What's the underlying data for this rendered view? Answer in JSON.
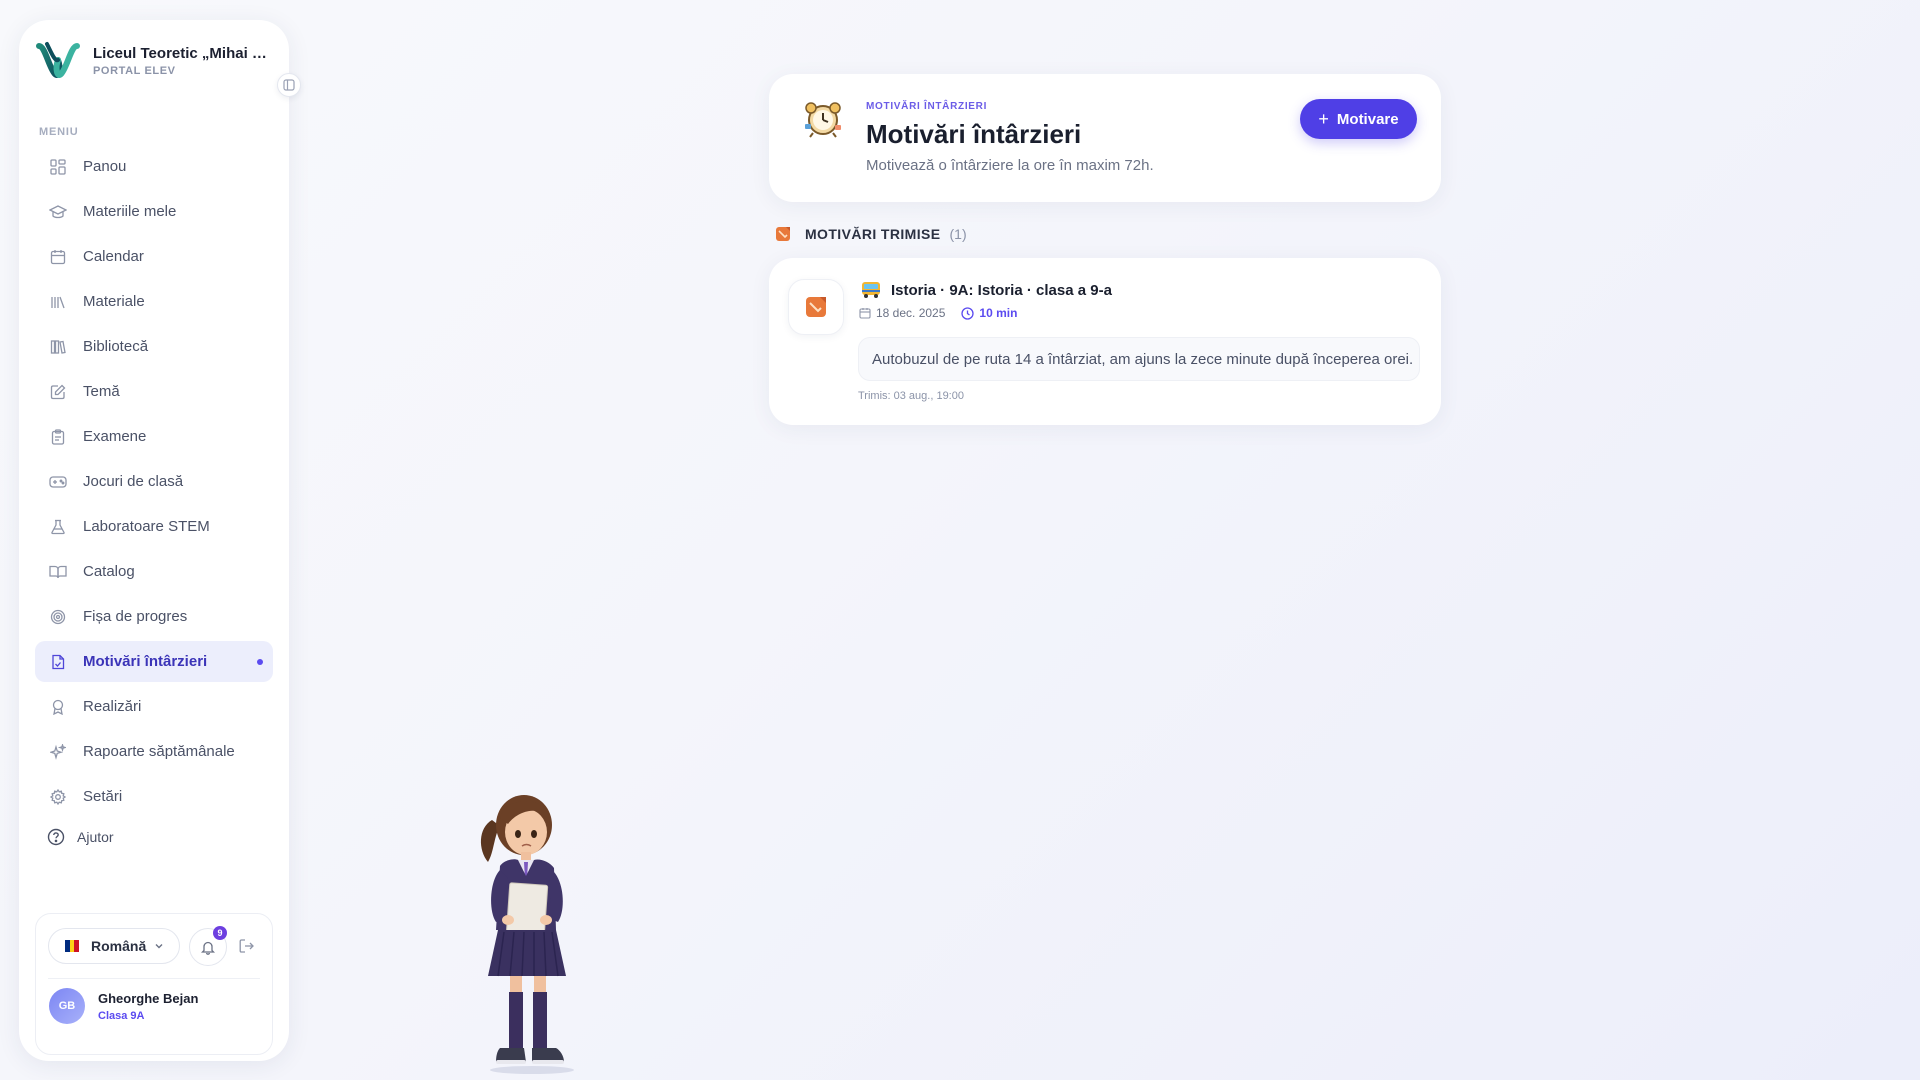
{
  "brand": {
    "name": "Liceul Teoretic „Mihai Eminescu”",
    "subtitle": "PORTAL ELEV"
  },
  "sidebar": {
    "menu_label": "MENIU",
    "items": [
      {
        "label": "Panou",
        "icon": "dashboard-icon"
      },
      {
        "label": "Materiile mele",
        "icon": "graduation-cap-icon"
      },
      {
        "label": "Calendar",
        "icon": "calendar-icon"
      },
      {
        "label": "Materiale",
        "icon": "books-icon"
      },
      {
        "label": "Bibliotecă",
        "icon": "library-icon"
      },
      {
        "label": "Temă",
        "icon": "edit-icon"
      },
      {
        "label": "Examene",
        "icon": "clipboard-icon"
      },
      {
        "label": "Jocuri de clasă",
        "icon": "gamepad-icon"
      },
      {
        "label": "Laboratoare STEM",
        "icon": "flask-icon"
      },
      {
        "label": "Catalog",
        "icon": "book-open-icon"
      },
      {
        "label": "Fișa de progres",
        "icon": "target-icon"
      },
      {
        "label": "Motivări întârzieri",
        "icon": "file-check-icon",
        "active": true
      },
      {
        "label": "Realizări",
        "icon": "award-icon"
      },
      {
        "label": "Rapoarte săptămânale",
        "icon": "sparkles-icon"
      },
      {
        "label": "Setări",
        "icon": "gear-icon"
      }
    ],
    "help_label": "Ajutor",
    "language": "Română",
    "notifications_count": "9",
    "user": {
      "initials": "GB",
      "name": "Gheorghe Bejan",
      "class": "Clasa 9A"
    }
  },
  "header": {
    "eyebrow": "MOTIVĂRI ÎNTÂRZIERI",
    "title": "Motivări întârzieri",
    "subtitle": "Motivează o întârziere la ore în maxim 72h.",
    "button_label": "Motivare"
  },
  "section": {
    "title": "MOTIVĂRI TRIMISE",
    "count": "(1)"
  },
  "submissions": [
    {
      "title": "Istoria · 9A: Istoria · clasa a 9-a",
      "date": "18 dec. 2025",
      "duration": "10 min",
      "note": "Autobuzul de pe ruta 14 a întârziat, am ajuns la zece minute după începerea orei.",
      "sent": "Trimis: 03 aug., 19:00"
    }
  ],
  "colors": {
    "accent": "#4f3fe6",
    "active_bg": "#eceefc",
    "background": "#f4f5fb"
  }
}
